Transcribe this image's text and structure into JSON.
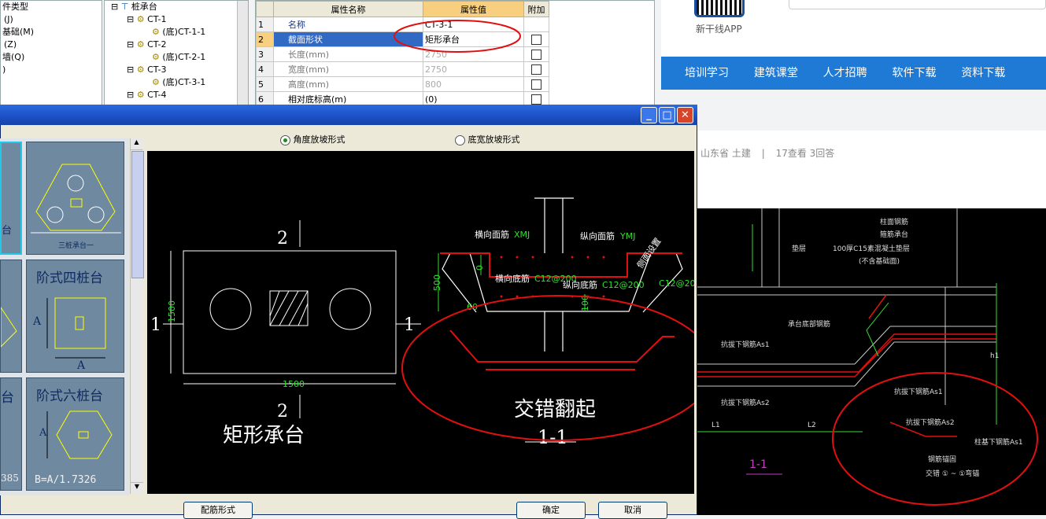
{
  "tree_left": {
    "items": [
      "件类型",
      "(J)",
      "基础(M)",
      "(Z)",
      "墙(Q)",
      ")"
    ]
  },
  "tree": {
    "items": [
      "桩承台",
      "CT-1",
      "(底)CT-1-1",
      "CT-2",
      "(底)CT-2-1",
      "CT-3",
      "(底)CT-3-1",
      "CT-4"
    ]
  },
  "property_grid": {
    "headers": [
      "属性名称",
      "属性值",
      "附加"
    ],
    "rows": [
      {
        "no": "1",
        "name": "名称",
        "value": "CT-3-1"
      },
      {
        "no": "2",
        "name": "截面形状",
        "value": "矩形承台"
      },
      {
        "no": "3",
        "name": "长度(mm)",
        "value": "2750"
      },
      {
        "no": "4",
        "name": "宽度(mm)",
        "value": "2750"
      },
      {
        "no": "5",
        "name": "高度(mm)",
        "value": "800"
      },
      {
        "no": "6",
        "name": "相对底标高(m)",
        "value": "(0)"
      }
    ]
  },
  "website": {
    "app_label": "新干线APP",
    "nav": [
      "培训学习",
      "建筑课堂",
      "人才招聘",
      "软件下载",
      "资料下载"
    ],
    "meta": {
      "province": "山东省",
      "category": "土建",
      "views": "17查看",
      "answers": "3回答"
    },
    "cad": {
      "notes": [
        "柱面钢筋",
        "箍筋承台",
        "垫层",
        "100厚C15素混凝土垫层",
        "(不含基础面)"
      ],
      "labels": [
        "承台底部钢筋",
        "抗拔下钢筋As1",
        "抗拔下钢筋As2",
        "抗拔下钢筋As1",
        "抗拔下钢筋As2",
        "柱基下钢筋As1",
        "钢筋锚固",
        "交错 ① ~ ①弯锚"
      ],
      "dims": [
        "L1",
        "L2",
        "h1"
      ],
      "section": "1-1"
    }
  },
  "dialog": {
    "title": "",
    "radio_angle": "角度放坡形式",
    "radio_width": "底宽放坡形式",
    "thumbs": [
      {
        "title": "三桩承台一"
      },
      {
        "title": "阶式四桩台",
        "dimA1": "A",
        "dimA2": "A"
      },
      {
        "title": "阶式六桩台",
        "dimA": "A",
        "formula": "B=A/1.7326"
      }
    ],
    "thumb_fragments": [
      "台",
      "台",
      "385"
    ],
    "buttons": {
      "reinforce": "配筋形式",
      "ok": "确定",
      "cancel": "取消"
    }
  },
  "drawing": {
    "title": "矩形承台",
    "label_top": "2",
    "label_bottom": "2",
    "label_left": "1",
    "label_right": "1",
    "dim_height": "1500",
    "dim_width": "1500",
    "section_title": "1-1",
    "dim_500": "500",
    "dim_0": "0",
    "dim_100": "100",
    "angle": "60",
    "rebar_top_h": "横向面筋",
    "rebar_top_h_val": "XMJ",
    "rebar_top_v": "纵向面筋",
    "rebar_top_v_val": "YMJ",
    "rebar_bot_h": "横向底筋",
    "rebar_bot_h_val": "C12@200",
    "rebar_bot_v": "纵向底筋",
    "rebar_bot_v_val": "C12@200",
    "rebar_side_val": "C12@200",
    "rebar_side_label": "侧面设置",
    "annotation": "交错翻起"
  },
  "colors": {
    "highlight": "#e01010",
    "nav": "#1f7ad6",
    "selected": "#316ac5"
  }
}
